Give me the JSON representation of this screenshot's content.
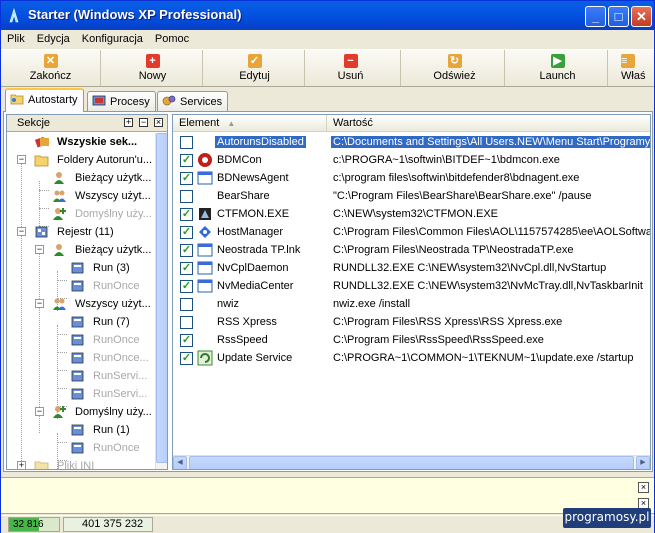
{
  "window": {
    "title": "Starter (Windows XP Professional)",
    "controls": [
      "minimize",
      "maximize",
      "close"
    ]
  },
  "menu": [
    "Plik",
    "Edycja",
    "Konfiguracja",
    "Pomoc"
  ],
  "toolbar": [
    {
      "label": "Zakończ",
      "icon": "exit-icon",
      "color": "#e8a53a"
    },
    {
      "label": "Nowy",
      "icon": "new-icon",
      "color": "#e23b2b"
    },
    {
      "label": "Edytuj",
      "icon": "edit-icon",
      "color": "#e8a53a"
    },
    {
      "label": "Usuń",
      "icon": "delete-icon",
      "color": "#e23b2b"
    },
    {
      "label": "Odśwież",
      "icon": "refresh-icon",
      "color": "#e8a53a"
    },
    {
      "label": "Launch",
      "icon": "launch-icon",
      "color": "#3aa13a"
    },
    {
      "label": "Właś",
      "icon": "properties-icon",
      "color": "#e8a53a"
    }
  ],
  "tabs": [
    {
      "label": "Autostarty",
      "active": true
    },
    {
      "label": "Procesy",
      "active": false
    },
    {
      "label": "Services",
      "active": false
    }
  ],
  "left_pane": {
    "header": "Sekcje",
    "tree": [
      {
        "label": "Wszyskie sek...",
        "bold": true
      },
      {
        "label": "Foldery Autorun'u..."
      },
      {
        "label": "Bieżący użytk..."
      },
      {
        "label": "Wszyscy użyt..."
      },
      {
        "label": "Domyślny uży...",
        "dim": true
      },
      {
        "label": "Rejestr (11)"
      },
      {
        "label": "Bieżący użytk..."
      },
      {
        "label": "Run (3)"
      },
      {
        "label": "RunOnce",
        "dim": true
      },
      {
        "label": "Wszyscy użyt..."
      },
      {
        "label": "Run (7)"
      },
      {
        "label": "RunOnce",
        "dim": true
      },
      {
        "label": "RunOnce...",
        "dim": true
      },
      {
        "label": "RunServi...",
        "dim": true
      },
      {
        "label": "RunServi...",
        "dim": true
      },
      {
        "label": "Domyślny uży..."
      },
      {
        "label": "Run (1)"
      },
      {
        "label": "RunOnce",
        "dim": true
      },
      {
        "label": "Pliki INI",
        "dim": true
      }
    ]
  },
  "list": {
    "columns": [
      "Element",
      "Wartość"
    ],
    "rows": [
      {
        "checked": false,
        "name": "AutorunsDisabled",
        "value": "C:\\Documents and Settings\\All Users.NEW\\Menu Start\\Programy\\",
        "selected": true,
        "icon": "none"
      },
      {
        "checked": true,
        "name": "BDMCon",
        "value": "c:\\PROGRA~1\\softwin\\BITDEF~1\\bdmcon.exe",
        "icon": "bitdefender-icon"
      },
      {
        "checked": true,
        "name": "BDNewsAgent",
        "value": "c:\\program files\\softwin\\bitdefender8\\bdnagent.exe",
        "icon": "window-icon"
      },
      {
        "checked": false,
        "name": "BearShare",
        "value": "\"C:\\Program Files\\BearShare\\BearShare.exe\" /pause",
        "icon": "none"
      },
      {
        "checked": true,
        "name": "CTFMON.EXE",
        "value": "C:\\NEW\\system32\\CTFMON.EXE",
        "icon": "ctfmon-icon"
      },
      {
        "checked": true,
        "name": "HostManager",
        "value": "C:\\Program Files\\Common Files\\AOL\\1157574285\\ee\\AOLSoftwa",
        "icon": "aol-icon"
      },
      {
        "checked": true,
        "name": "Neostrada TP.lnk",
        "value": "C:\\Program Files\\Neostrada TP\\NeostradaTP.exe",
        "icon": "window-icon"
      },
      {
        "checked": true,
        "name": "NvCplDaemon",
        "value": "RUNDLL32.EXE C:\\NEW\\system32\\NvCpl.dll,NvStartup",
        "icon": "window-icon"
      },
      {
        "checked": true,
        "name": "NvMediaCenter",
        "value": "RUNDLL32.EXE C:\\NEW\\system32\\NvMcTray.dll,NvTaskbarInit",
        "icon": "window-icon"
      },
      {
        "checked": false,
        "name": "nwiz",
        "value": "nwiz.exe /install",
        "icon": "none"
      },
      {
        "checked": false,
        "name": "RSS Xpress",
        "value": "C:\\Program Files\\RSS Xpress\\RSS Xpress.exe",
        "icon": "none"
      },
      {
        "checked": true,
        "name": "RssSpeed",
        "value": "C:\\Program Files\\RssSpeed\\RssSpeed.exe",
        "icon": "none"
      },
      {
        "checked": true,
        "name": "Update Service",
        "value": "C:\\PROGRA~1\\COMMON~1\\TEKNUM~1\\update.exe /startup",
        "icon": "update-icon"
      }
    ]
  },
  "status": {
    "progress_label": "32 816",
    "progress_fraction": 0.6,
    "memory": "401 375 232"
  },
  "watermark": "programosy.pl"
}
